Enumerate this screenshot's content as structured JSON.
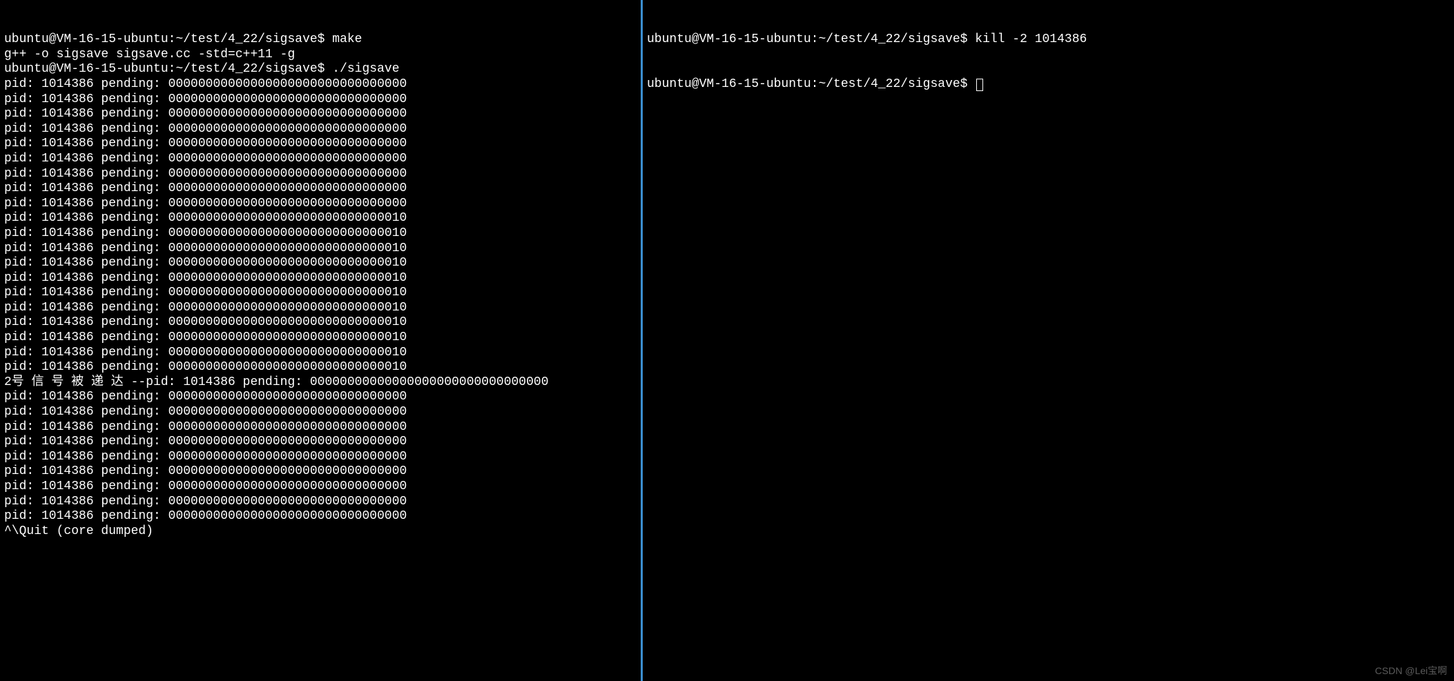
{
  "left": {
    "lines": [
      "ubuntu@VM-16-15-ubuntu:~/test/4_22/sigsave$ make",
      "g++ -o sigsave sigsave.cc -std=c++11 -g",
      "ubuntu@VM-16-15-ubuntu:~/test/4_22/sigsave$ ./sigsave",
      "pid: 1014386 pending: 00000000000000000000000000000000",
      "pid: 1014386 pending: 00000000000000000000000000000000",
      "pid: 1014386 pending: 00000000000000000000000000000000",
      "pid: 1014386 pending: 00000000000000000000000000000000",
      "pid: 1014386 pending: 00000000000000000000000000000000",
      "pid: 1014386 pending: 00000000000000000000000000000000",
      "pid: 1014386 pending: 00000000000000000000000000000000",
      "pid: 1014386 pending: 00000000000000000000000000000000",
      "pid: 1014386 pending: 00000000000000000000000000000000",
      "pid: 1014386 pending: 00000000000000000000000000000010",
      "pid: 1014386 pending: 00000000000000000000000000000010",
      "pid: 1014386 pending: 00000000000000000000000000000010",
      "pid: 1014386 pending: 00000000000000000000000000000010",
      "pid: 1014386 pending: 00000000000000000000000000000010",
      "pid: 1014386 pending: 00000000000000000000000000000010",
      "pid: 1014386 pending: 00000000000000000000000000000010",
      "pid: 1014386 pending: 00000000000000000000000000000010",
      "pid: 1014386 pending: 00000000000000000000000000000010",
      "pid: 1014386 pending: 00000000000000000000000000000010",
      "pid: 1014386 pending: 00000000000000000000000000000010",
      "2号 信 号 被 递 达 --pid: 1014386 pending: 00000000000000000000000000000000",
      "pid: 1014386 pending: 00000000000000000000000000000000",
      "pid: 1014386 pending: 00000000000000000000000000000000",
      "pid: 1014386 pending: 00000000000000000000000000000000",
      "pid: 1014386 pending: 00000000000000000000000000000000",
      "pid: 1014386 pending: 00000000000000000000000000000000",
      "pid: 1014386 pending: 00000000000000000000000000000000",
      "pid: 1014386 pending: 00000000000000000000000000000000",
      "pid: 1014386 pending: 00000000000000000000000000000000",
      "pid: 1014386 pending: 00000000000000000000000000000000",
      "^\\Quit (core dumped)"
    ]
  },
  "right": {
    "line1": "ubuntu@VM-16-15-ubuntu:~/test/4_22/sigsave$ kill -2 1014386",
    "line2_prompt": "ubuntu@VM-16-15-ubuntu:~/test/4_22/sigsave$ "
  },
  "watermark": "CSDN @Lei宝啊"
}
